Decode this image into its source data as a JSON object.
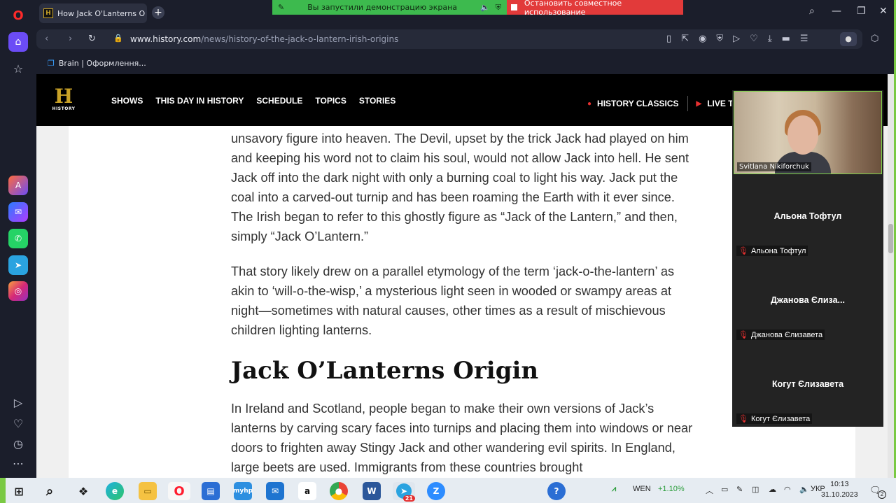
{
  "browser": {
    "tab_title": "How Jack O'Lanterns Orig",
    "url_domain": "www.history.com",
    "url_path": "/news/history-of-the-jack-o-lantern-irish-origins",
    "bookmark": "Brain | Оформлення..."
  },
  "share_bar": {
    "message": "Вы запустили демонстрацию экрана",
    "stop_label": "Остановить совместное использование"
  },
  "site_nav": {
    "logo_text": "HISTORY",
    "links": [
      "SHOWS",
      "THIS DAY IN HISTORY",
      "SCHEDULE",
      "TOPICS",
      "STORIES"
    ],
    "classics": "HISTORY CLASSICS",
    "live": "LIVE TV"
  },
  "article": {
    "p1": "unsavory figure into heaven. The Devil, upset by the trick Jack had played on him and keeping his word not to claim his soul, would not allow Jack into hell. He sent Jack off into the dark night with only a burning coal to light his way. Jack put the coal into a carved-out turnip and has been roaming the Earth with it ever since. The Irish began to refer to this ghostly figure as “Jack of the Lantern,” and then, simply “Jack O’Lantern.”",
    "p2": "That story likely drew on a parallel etymology of the term ‘jack-o-the-lantern’ as akin to ‘will-o-the-wisp,’ a mysterious light seen in wooded or swampy areas at night—sometimes with natural causes, other times as a result of mischievous children lighting lanterns.",
    "heading": "Jack O’Lanterns Origin",
    "p3": "In Ireland and Scotland, people began to make their own versions of Jack’s lanterns by carving scary faces into turnips and placing them into windows or near doors to frighten away Stingy Jack and other wandering evil spirits. In England, large beets are used. Immigrants from these countries brought"
  },
  "call": {
    "camera_name": "Svitlana Nikiforchuk",
    "participants": [
      {
        "display": "Альона Тофтул",
        "label": "Альона Тофтул"
      },
      {
        "display": "Джанова Єлиза...",
        "label": "Джанова Єлизавета"
      },
      {
        "display": "Когут Єлизавета",
        "label": "Когут Єлизавета"
      }
    ]
  },
  "taskbar": {
    "stock_ticker": "WEN",
    "stock_change": "+1.10%",
    "language": "УКР",
    "time": "10:13",
    "date": "31.10.2023",
    "telegram_badge": "21",
    "notif_count": "2"
  },
  "colors": {
    "share_green": "#3dba4e",
    "share_red": "#e23a3a",
    "history_gold": "#c9a227",
    "frame_green": "#7ac943"
  }
}
